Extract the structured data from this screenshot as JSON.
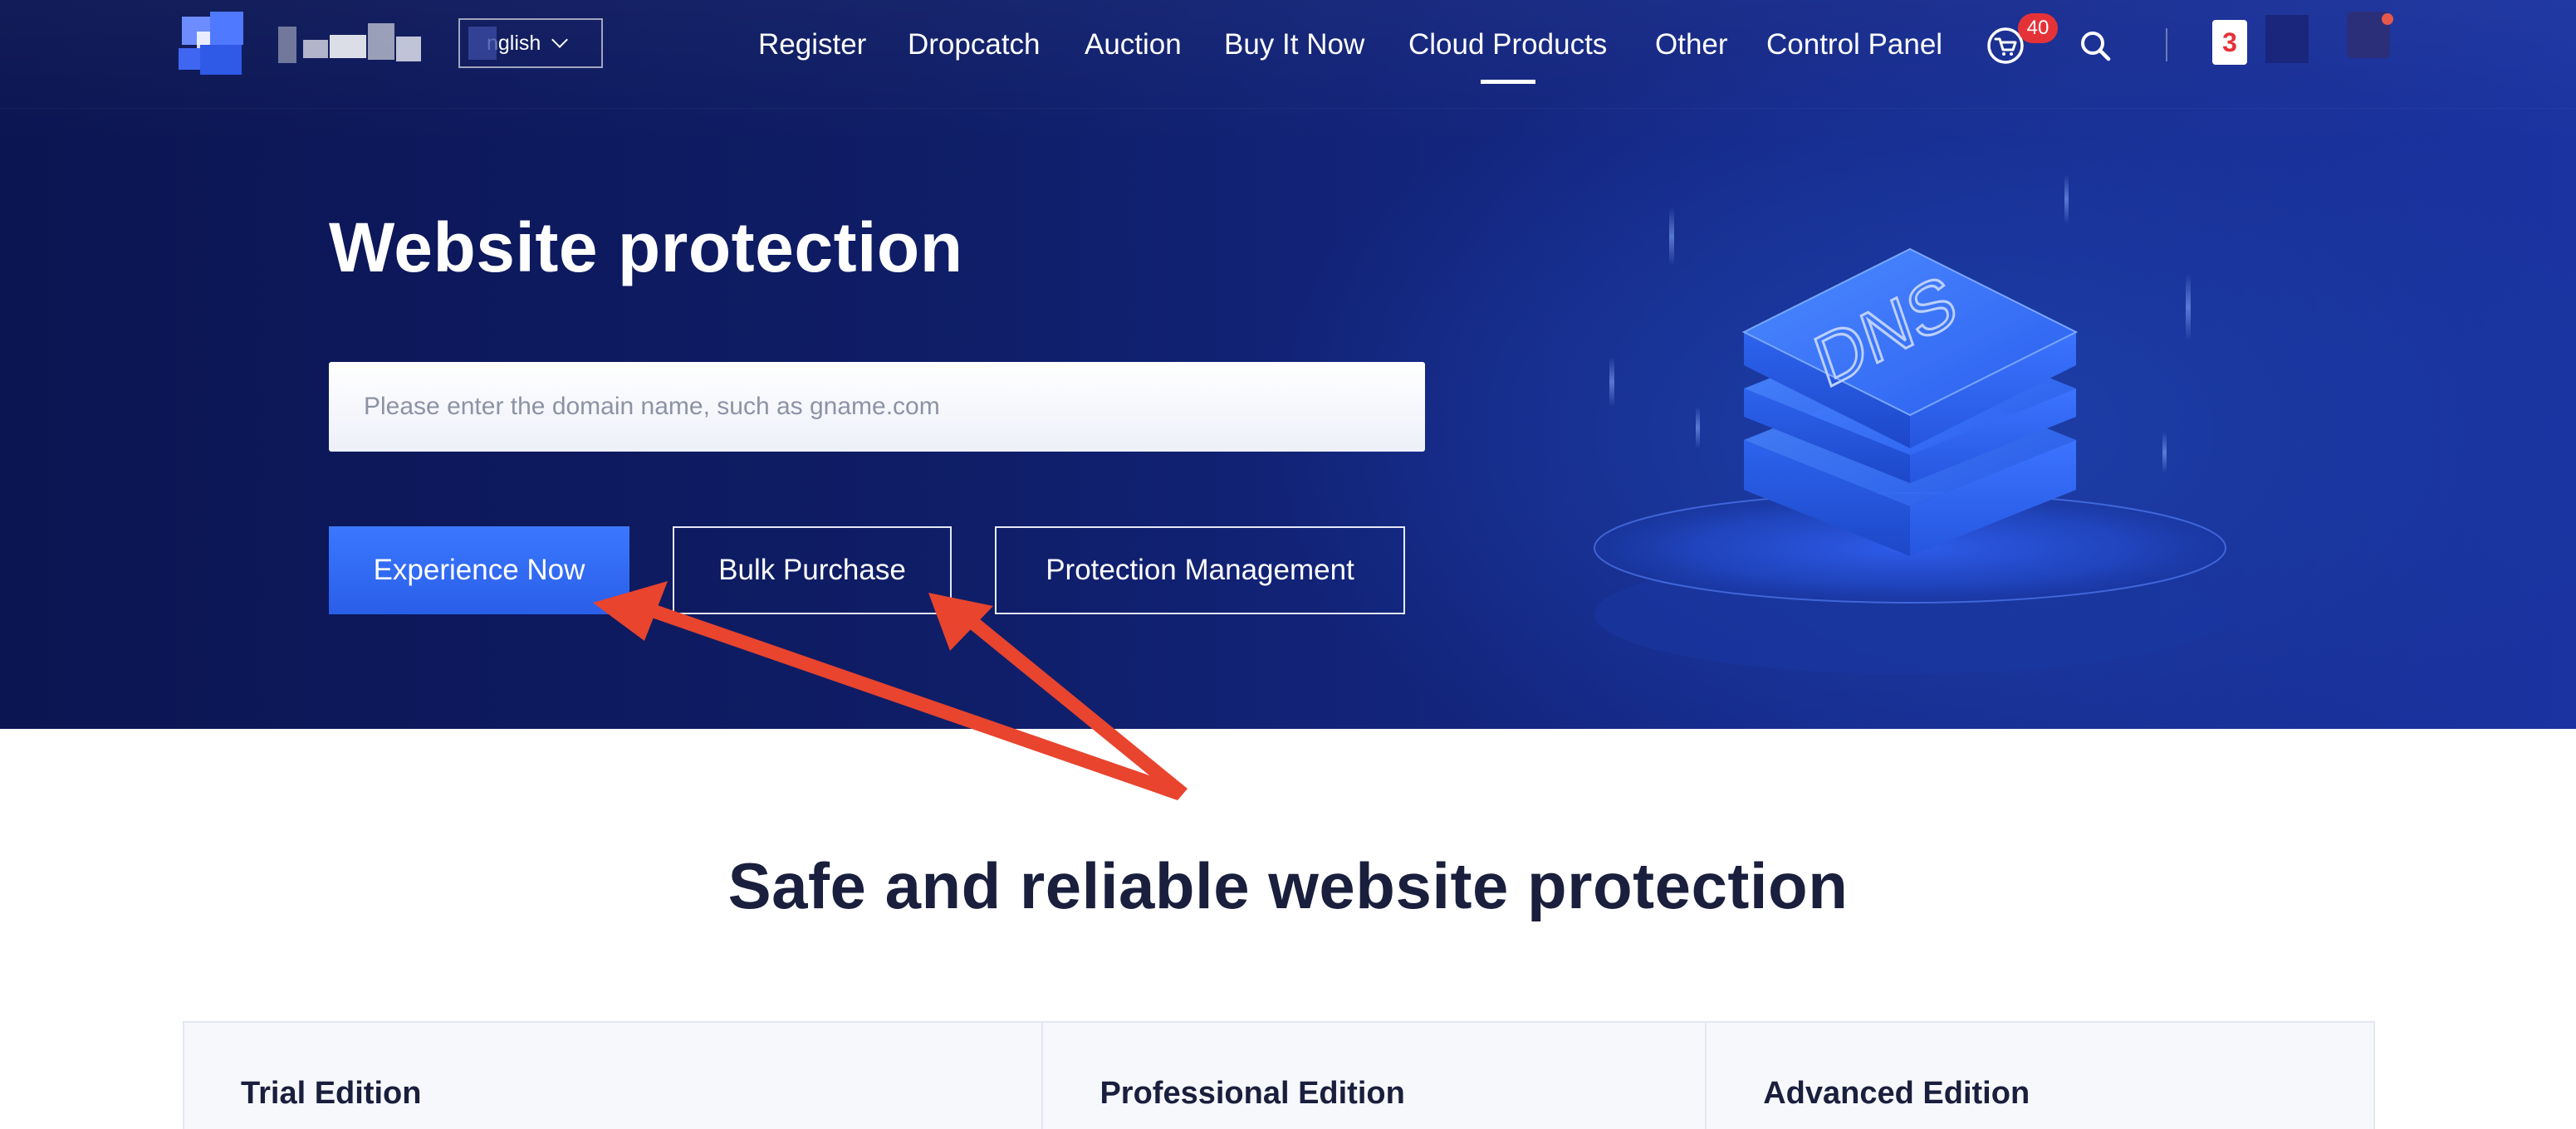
{
  "nav": {
    "language": "nglish",
    "menu": [
      "Register",
      "Dropcatch",
      "Auction",
      "Buy It Now",
      "Cloud Products",
      "Other",
      "Control Panel"
    ],
    "active": "Cloud Products",
    "cart_count": "40",
    "notice_number": "3"
  },
  "hero": {
    "title": "Website protection",
    "search_placeholder": "Please enter the domain name, such as gname.com",
    "buttons": {
      "experience": "Experience Now",
      "bulk": "Bulk Purchase",
      "manage": "Protection Management"
    },
    "illustration_text": "DNS"
  },
  "section": {
    "title": "Safe and reliable website protection",
    "plans": [
      "Trial Edition",
      "Professional Edition",
      "Advanced Edition"
    ]
  },
  "colors": {
    "hero_dark": "#0b1552",
    "primary_button": "#2f6bff",
    "badge": "#e53238",
    "arrow": "#e8442e"
  },
  "icons": [
    "cart-icon",
    "search-icon",
    "chevron-down-icon",
    "dns-stack-icon"
  ]
}
